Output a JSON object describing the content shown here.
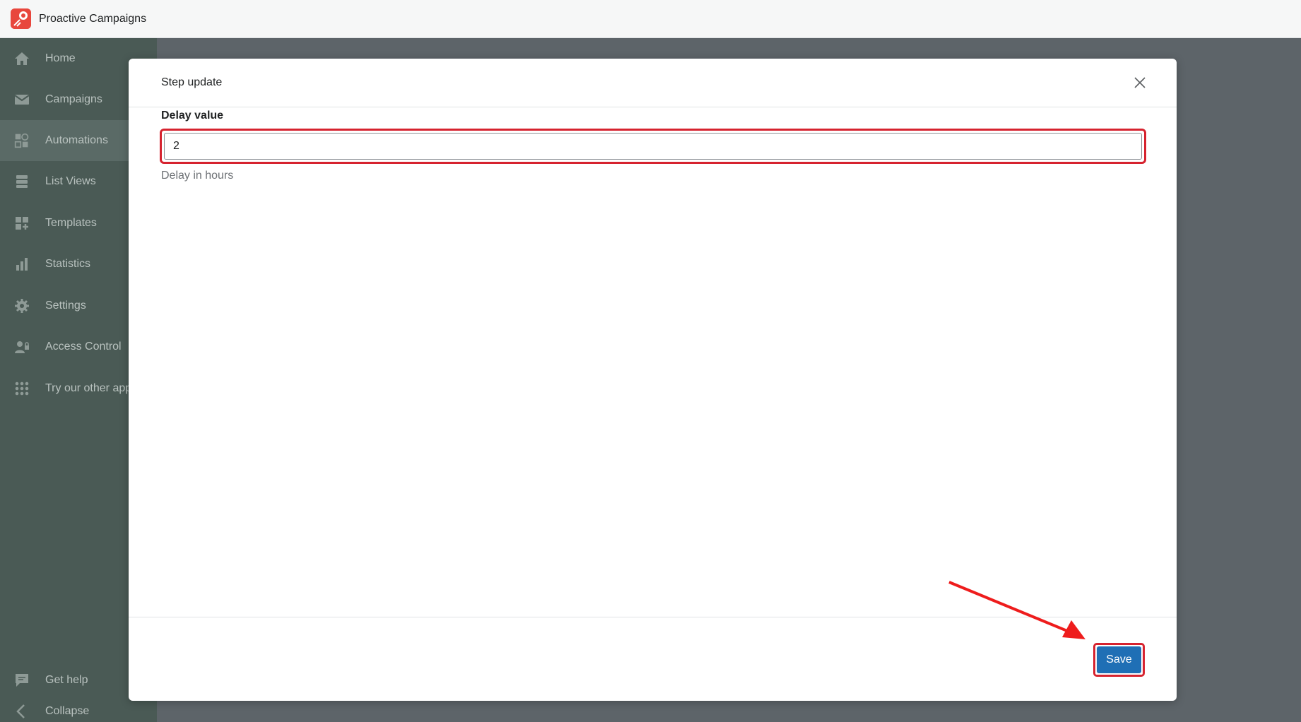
{
  "app": {
    "title": "Proactive Campaigns",
    "brand_color": "#e8473d"
  },
  "sidebar": {
    "items": [
      {
        "label": "Home",
        "icon": "home-icon"
      },
      {
        "label": "Campaigns",
        "icon": "mail-icon"
      },
      {
        "label": "Automations",
        "icon": "automation-icon",
        "active": true
      },
      {
        "label": "List Views",
        "icon": "list-icon"
      },
      {
        "label": "Templates",
        "icon": "templates-icon"
      },
      {
        "label": "Statistics",
        "icon": "bar-chart-icon"
      },
      {
        "label": "Settings",
        "icon": "gear-icon"
      },
      {
        "label": "Access Control",
        "icon": "user-lock-icon"
      },
      {
        "label": "Try our other apps",
        "icon": "grid-dots-icon"
      }
    ],
    "bottom_items": [
      {
        "label": "Get help",
        "icon": "chat-icon"
      },
      {
        "label": "Collapse",
        "icon": "chevron-left-icon"
      }
    ]
  },
  "modal": {
    "title": "Step update",
    "field_label": "Delay value",
    "field_value": "2",
    "help_text": "Delay in hours",
    "save_label": "Save"
  },
  "colors": {
    "primary_button": "#1f6fb5",
    "highlight": "#d6232f"
  }
}
